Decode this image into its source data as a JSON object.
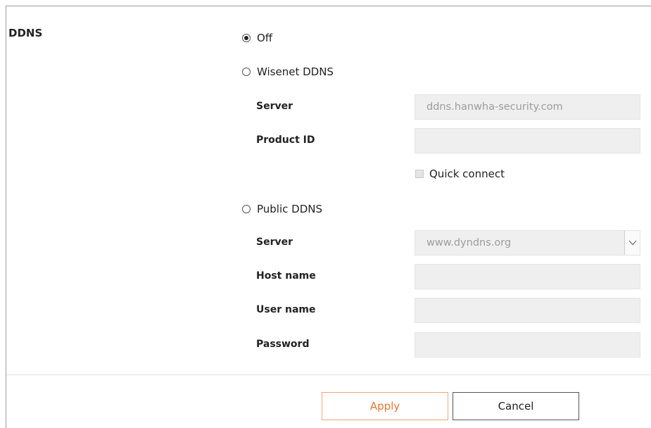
{
  "section": {
    "title": "DDNS"
  },
  "mode_options": [
    {
      "label": "Off",
      "checked": true
    },
    {
      "label": "Wisenet DDNS",
      "checked": false
    },
    {
      "label": "Public DDNS",
      "checked": false
    }
  ],
  "wisenet": {
    "server_label": "Server",
    "server_value": "ddns.hanwha-security.com",
    "product_id_label": "Product ID",
    "product_id_value": "",
    "quick_connect_label": "Quick connect",
    "quick_connect_checked": false
  },
  "public": {
    "server_label": "Server",
    "server_selected": "www.dyndns.org",
    "host_name_label": "Host name",
    "host_name_value": "",
    "user_name_label": "User name",
    "user_name_value": "",
    "password_label": "Password",
    "password_value": ""
  },
  "buttons": {
    "apply": "Apply",
    "cancel": "Cancel"
  },
  "colors": {
    "accent": "#e8742f",
    "accent_border": "#f4a57a",
    "field_bg": "#efefef"
  }
}
